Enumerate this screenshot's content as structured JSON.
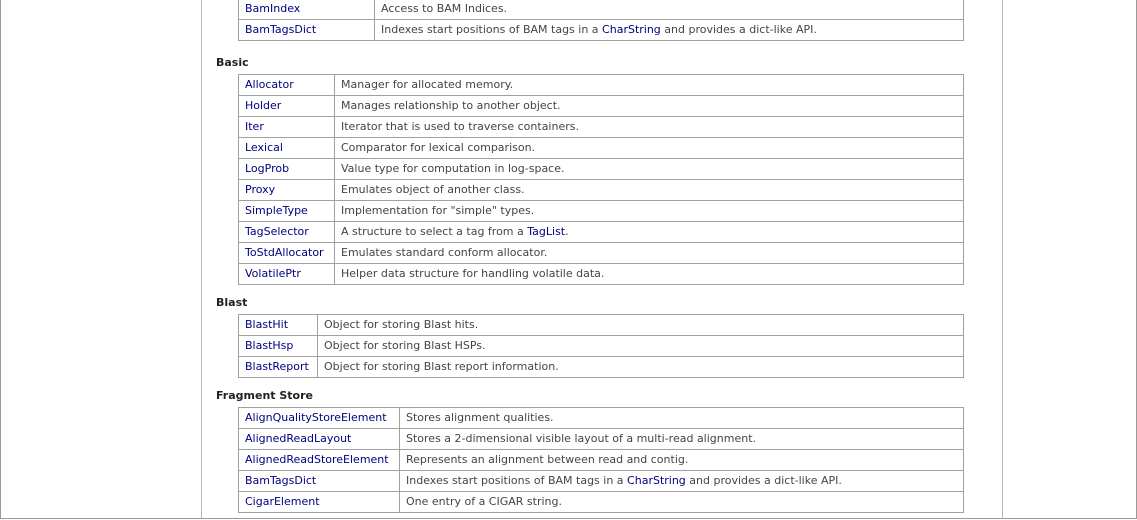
{
  "page": {
    "sections": [
      {
        "title": "",
        "rows": [
          {
            "name": "BamIndex",
            "desc": [
              {
                "t": "Access to BAM Indices."
              }
            ]
          },
          {
            "name": "BamTagsDict",
            "desc": [
              {
                "t": "Indexes start positions of BAM tags in a "
              },
              {
                "t": "CharString",
                "link": true
              },
              {
                "t": " and provides a dict-like API."
              }
            ]
          }
        ]
      },
      {
        "title": "Basic",
        "rows": [
          {
            "name": "Allocator",
            "desc": [
              {
                "t": "Manager for allocated memory."
              }
            ]
          },
          {
            "name": "Holder",
            "desc": [
              {
                "t": "Manages relationship to another object."
              }
            ]
          },
          {
            "name": "Iter",
            "desc": [
              {
                "t": "Iterator that is used to traverse containers."
              }
            ]
          },
          {
            "name": "Lexical",
            "desc": [
              {
                "t": "Comparator for lexical comparison."
              }
            ]
          },
          {
            "name": "LogProb",
            "desc": [
              {
                "t": "Value type for computation in log-space."
              }
            ]
          },
          {
            "name": "Proxy",
            "desc": [
              {
                "t": "Emulates object of another class."
              }
            ]
          },
          {
            "name": "SimpleType",
            "desc": [
              {
                "t": "Implementation for \"simple\" types."
              }
            ]
          },
          {
            "name": "TagSelector",
            "desc": [
              {
                "t": "A structure to select a tag from a "
              },
              {
                "t": "TagList",
                "link": true
              },
              {
                "t": "."
              }
            ]
          },
          {
            "name": "ToStdAllocator",
            "desc": [
              {
                "t": "Emulates standard conform allocator."
              }
            ]
          },
          {
            "name": "VolatilePtr",
            "desc": [
              {
                "t": "Helper data structure for handling volatile data."
              }
            ]
          }
        ]
      },
      {
        "title": "Blast",
        "rows": [
          {
            "name": "BlastHit",
            "desc": [
              {
                "t": "Object for storing Blast hits."
              }
            ]
          },
          {
            "name": "BlastHsp",
            "desc": [
              {
                "t": "Object for storing Blast HSPs."
              }
            ]
          },
          {
            "name": "BlastReport",
            "desc": [
              {
                "t": "Object for storing Blast report information."
              }
            ]
          }
        ]
      },
      {
        "title": "Fragment Store",
        "rows": [
          {
            "name": "AlignQualityStoreElement",
            "desc": [
              {
                "t": "Stores alignment qualities."
              }
            ]
          },
          {
            "name": "AlignedReadLayout",
            "desc": [
              {
                "t": "Stores a 2-dimensional visible layout of a multi-read alignment."
              }
            ]
          },
          {
            "name": "AlignedReadStoreElement",
            "desc": [
              {
                "t": "Represents an alignment between read and contig."
              }
            ]
          },
          {
            "name": "BamTagsDict",
            "desc": [
              {
                "t": "Indexes start positions of BAM tags in a "
              },
              {
                "t": "CharString",
                "link": true
              },
              {
                "t": " and provides a dict-like API."
              }
            ]
          },
          {
            "name": "CigarElement",
            "desc": [
              {
                "t": "One entry of a CIGAR string."
              }
            ]
          }
        ]
      }
    ]
  }
}
